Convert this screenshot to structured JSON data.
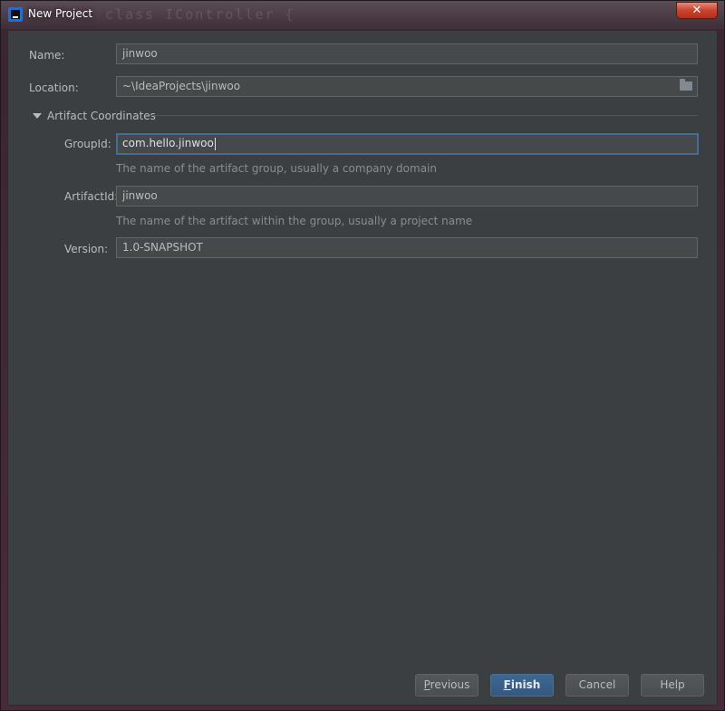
{
  "window": {
    "title": "New Project",
    "background_title": "class IController {",
    "close_label": "✕"
  },
  "form": {
    "name": {
      "label": "Name:",
      "value": "jinwoo"
    },
    "location": {
      "label": "Location:",
      "value": "~\\IdeaProjects\\jinwoo",
      "folder_icon": "folder-icon"
    },
    "section": {
      "label": "Artifact Coordinates",
      "expanded": true
    },
    "group_id": {
      "label": "GroupId:",
      "value": "com.hello.jinwoo",
      "hint": "The name of the artifact group, usually a company domain"
    },
    "artifact_id": {
      "label": "ArtifactId:",
      "value": "jinwoo",
      "hint": "The name of the artifact within the group, usually a project name"
    },
    "version": {
      "label": "Version:",
      "value": "1.0-SNAPSHOT"
    }
  },
  "buttons": {
    "previous": {
      "mnemonic": "P",
      "rest": "revious"
    },
    "finish": {
      "mnemonic": "F",
      "rest": "inish"
    },
    "cancel": "Cancel",
    "help": "Help"
  },
  "colors": {
    "panel": "#3c3f41",
    "field": "#45494a",
    "focus_border": "#466d94",
    "primary_button": "#365880",
    "close_button": "#c9432e"
  }
}
